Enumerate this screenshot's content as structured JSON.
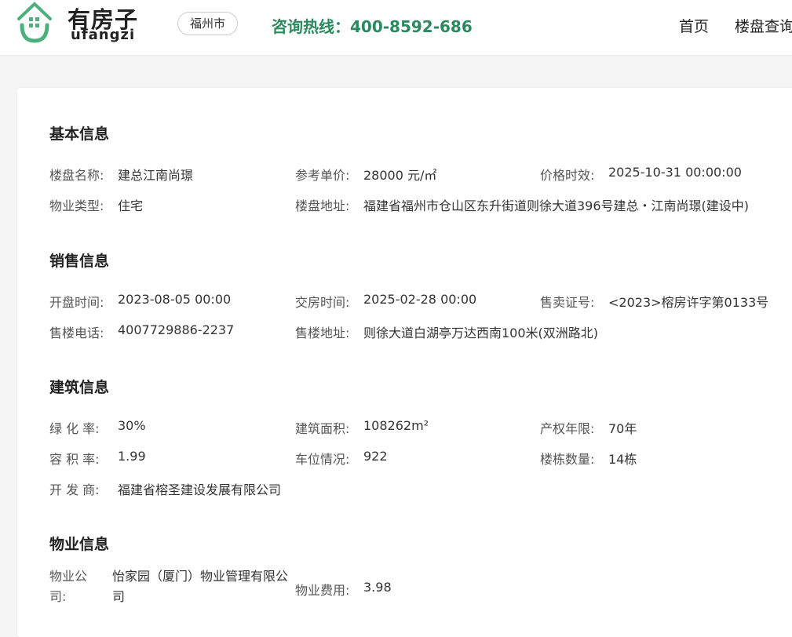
{
  "header": {
    "logo_cn": "有房子",
    "logo_en": "ufangzi",
    "city": "福州市",
    "hotline": "咨询热线：400-8592-686",
    "nav": [
      "首页",
      "楼盘查询"
    ]
  },
  "sections": [
    {
      "title": "基本信息",
      "rows": [
        [
          {
            "label": "楼盘名称:",
            "value": "建总江南尚璟"
          },
          {
            "label": "参考单价:",
            "value": "28000 元/㎡"
          },
          {
            "label": "价格时效:",
            "value": "2025-10-31 00:00:00"
          }
        ],
        [
          {
            "label": "物业类型:",
            "value": "住宅"
          },
          {
            "label": "楼盘地址:",
            "value": "福建省福州市仓山区东升街道则徐大道396号建总・江南尚璟(建设中)"
          }
        ]
      ]
    },
    {
      "title": "销售信息",
      "rows": [
        [
          {
            "label": "开盘时间:",
            "value": "2023-08-05 00:00"
          },
          {
            "label": "交房时间:",
            "value": "2025-02-28 00:00"
          },
          {
            "label": "售卖证号:",
            "value": "<2023>榕房许字第0133号"
          }
        ],
        [
          {
            "label": "售楼电话:",
            "value": "4007729886-2237"
          },
          {
            "label": "售楼地址:",
            "value": "则徐大道白湖亭万达西南100米(双洲路北)"
          }
        ]
      ]
    },
    {
      "title": "建筑信息",
      "rows": [
        [
          {
            "label": "绿 化 率:",
            "value": "30%"
          },
          {
            "label": "建筑面积:",
            "value": "108262m²"
          },
          {
            "label": "产权年限:",
            "value": "70年"
          }
        ],
        [
          {
            "label": "容 积 率:",
            "value": "1.99"
          },
          {
            "label": "车位情况:",
            "value": "922"
          },
          {
            "label": "楼栋数量:",
            "value": "14栋"
          }
        ],
        [
          {
            "label": "开 发 商:",
            "value": "福建省榕圣建设发展有限公司"
          }
        ]
      ]
    },
    {
      "title": "物业信息",
      "rows": [
        [
          {
            "label": "物业公司:",
            "value": "怡家园（厦门）物业管理有限公司"
          },
          {
            "label": "物业费用:",
            "value": "3.98"
          }
        ]
      ]
    }
  ]
}
